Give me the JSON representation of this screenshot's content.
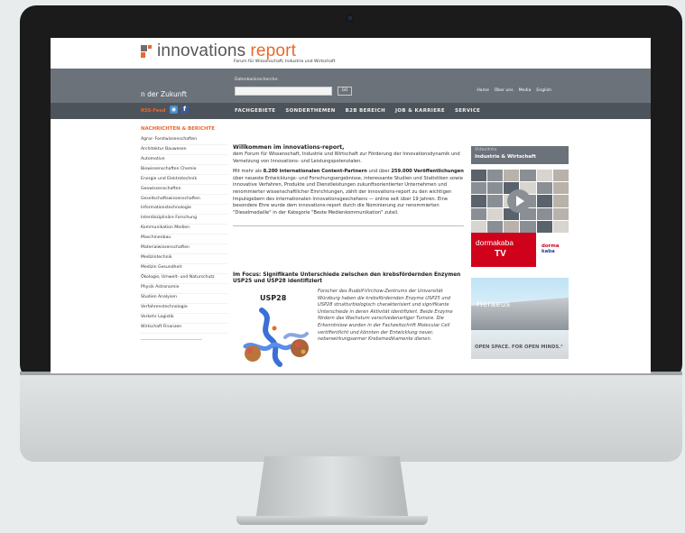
{
  "site": {
    "logo_word1": "innovations",
    "logo_word2": "report",
    "tagline": "Forum für Wissenschaft, Industrie und Wirtschaft",
    "header_text": "n der Zukunft",
    "search": {
      "label": "Datenbankrecherche:",
      "value": "",
      "go_label": "GO"
    },
    "top_links": [
      "Home",
      "Über uns",
      "Media",
      "English"
    ],
    "rss_label": "RSS-Feed",
    "nav": [
      "FACHGEBIETE",
      "SONDERTHEMEN",
      "B2B BEREICH",
      "JOB & KARRIERE",
      "SERVICE"
    ]
  },
  "sidebar": {
    "heading": "NACHRICHTEN & BERICHTE",
    "items": [
      "Agrar- Forstwissenschaften",
      "Architektur Bauwesen",
      "Automotive",
      "Biowissenschaften Chemie",
      "Energie und Elektrotechnik",
      "Geowissenschaften",
      "Gesellschaftswissenschaften",
      "Informationstechnologie",
      "Interdisziplinäre Forschung",
      "Kommunikation Medien",
      "Maschinenbau",
      "Materialwissenschaften",
      "Medizintechnik",
      "Medizin Gesundheit",
      "Ökologie, Umwelt- und Naturschutz",
      "Physik Astronomie",
      "Studien Analysen",
      "Verfahrenstechnologie",
      "Verkehr Logistik",
      "Wirtschaft Finanzen"
    ]
  },
  "welcome": {
    "title": "Willkommen im innovations-report,",
    "p1": "dem Forum für Wissenschaft, Industrie und Wirtschaft zur Förderung der Innovationsdynamik und Vernetzung von Innovations- und Leistungspotenzialen.",
    "p2_pre": "Mit mehr als ",
    "p2_bold1": "8.200 internationalen Content-Partnern",
    "p2_mid": " und über ",
    "p2_bold2": "259.000 Veröffentlichungen",
    "p2_post": " über neueste Entwicklungs- und Forschungsergebnisse, interessante Studien und Statistiken sowie innovative Verfahren, Produkte und Dienstleistungen zukunftsorientierter Unternehmen und renommierter wissenschaftlicher Einrichtungen, zählt der innovations-report zu den wichtigen Impulsgebern des internationalen Innovationsgeschehens — online seit über 19 Jahren. Eine besondere Ehre wurde dem innovations-report durch die Nominierung zur renommierten \"Dieselmedaille\" in der Kategorie \"Beste Medienkommunikation\" zuteil."
  },
  "focus": {
    "title": "Im Focus: Signifikante Unterschiede zwischen den krebsfördernden Enzymen USP25 und USP28 identifiziert",
    "image_label": "USP28",
    "text": "Forscher des Rudolf-Virchow-Zentrums der Universität Würzburg haben die krebsfördernden Enzyme USP25 und USP28 strukturbiologisch charakterisiert und signifikante Unterschiede in deren Aktivität identifiziert. Beide Enzyme fördern das Wachstum verschiedenartiger Tumore. Die Erkenntnisse wurden in der Fachzeitschrift Molecular Cell veröffentlicht und könnten der Entwicklung neuer, nebenwirkungsarmer Krebsmedikamente dienen."
  },
  "right": {
    "video_small": "Videolinks",
    "video_title": "Industrie & Wirtschaft",
    "dk_name": "dormakaba",
    "dk_tv": "TV",
    "dk_logo1": "dorma",
    "dk_logo2": "kaba",
    "heraeus_word": "Heraeus",
    "heraeus_slogan": "OPEN SPACE. FOR OPEN MINDS.°"
  }
}
